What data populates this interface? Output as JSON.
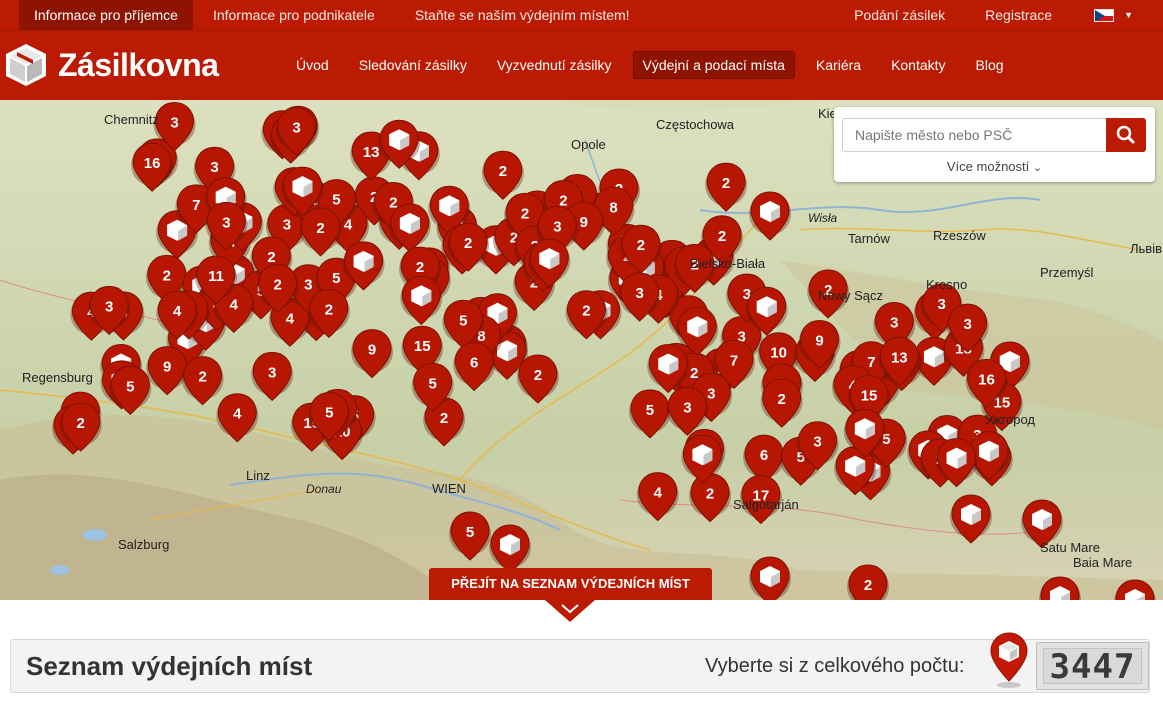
{
  "topbar": {
    "links": [
      "Informace pro příjemce",
      "Informace pro podnikatele",
      "Staňte se naším výdejním místem!"
    ],
    "right_links": [
      "Podání zásilek",
      "Registrace"
    ],
    "language_flag": "czech-flag"
  },
  "header": {
    "logo_text": "Zásilkovna",
    "nav": [
      "Úvod",
      "Sledování zásilky",
      "Vyzvednutí zásilky",
      "Výdejní a podací místa",
      "Kariéra",
      "Kontakty",
      "Blog"
    ],
    "active_nav": "Výdejní a podací místa"
  },
  "search": {
    "placeholder": "Napište město nebo PSČ",
    "more_label": "Více možností"
  },
  "map": {
    "cities": [
      "Chemnitz",
      "Opole",
      "Częstochowa",
      "Kielce",
      "Regensburg",
      "Linz",
      "WIEN",
      "Salzburg",
      "Tarnów",
      "Rzeszów",
      "Krosno",
      "Nowy Sącz",
      "Bielsko-Biała",
      "Baia Mare",
      "Львів",
      "Przemyśl",
      "Wisła",
      "Donau",
      "Salgótarján",
      "Ужгород",
      "Satu Mare"
    ],
    "pins": [
      "3",
      "2",
      "2",
      "6",
      "6",
      "4",
      "3",
      "7",
      "5",
      "2",
      "4",
      "2",
      "17",
      "9",
      "3",
      "7",
      "4",
      "5",
      "15",
      "2",
      "15",
      "3",
      "13",
      "16",
      "13",
      "3",
      "5",
      "7",
      "4",
      "3",
      "12",
      "3",
      "2",
      "2",
      "4",
      "2",
      "5",
      "15",
      "15",
      "2",
      "5",
      "2",
      "4",
      "5",
      "10",
      "2",
      "2",
      "2",
      "5",
      "9",
      "5",
      "3",
      "11",
      "2",
      "3",
      "8",
      "11",
      "5",
      "3",
      "2",
      "3",
      "2",
      "5",
      "4",
      "2",
      "3",
      "2",
      "3",
      "2",
      "2",
      "6",
      "2",
      "2",
      "3",
      "2",
      "3",
      "2",
      "2",
      "3",
      "2",
      "2",
      "2",
      "7",
      "2",
      "8",
      "2",
      "3",
      "2",
      "2",
      "10",
      "2",
      "9",
      "2",
      "4",
      "3",
      "2",
      "3",
      "2",
      "2",
      "2",
      "2",
      "2"
    ]
  },
  "callout_label": "PŘEJÍT NA SEZNAM VÝDEJNÍCH MÍST",
  "list": {
    "title": "Seznam výdejních míst",
    "subtitle": "Vyberte si z celkového počtu:",
    "count": "3447"
  },
  "colors": {
    "brand": "#ba1b02",
    "brand_dark": "#8e1300"
  }
}
